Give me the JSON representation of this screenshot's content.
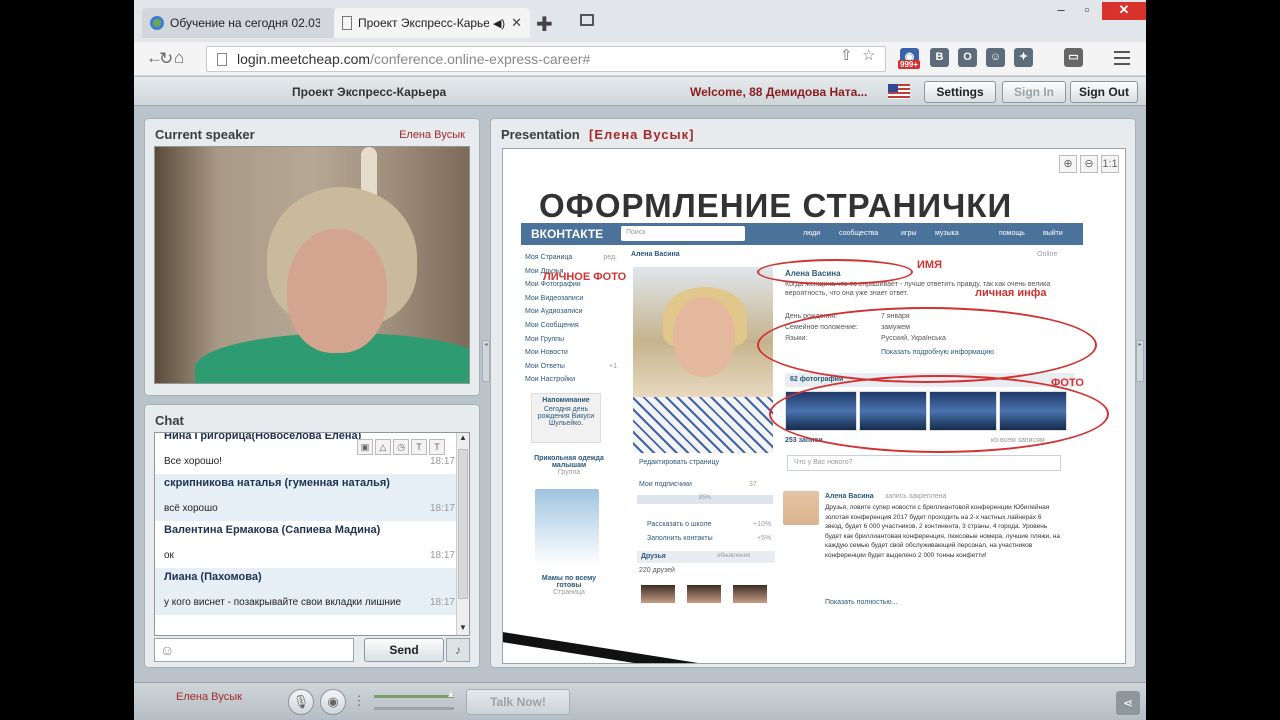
{
  "browser": {
    "tabs": [
      {
        "title": "Обучение на сегодня 02.03."
      },
      {
        "title": "Проект Экспресс-Карьера",
        "audio_icon": "speaker-icon"
      }
    ],
    "url_domain": "login.meetcheap.com",
    "url_path": "/conference.online-express-career#",
    "badge": "999+",
    "extensions": [
      "В",
      "О"
    ]
  },
  "header": {
    "title": "Проект Экспресс-Карьера",
    "welcome": "Welcome, 88 Демидова Ната...",
    "buttons": {
      "settings": "Settings",
      "sign_in": "Sign In",
      "sign_out": "Sign Out"
    }
  },
  "speaker_panel": {
    "title": "Current speaker",
    "name": "Елена Вусык"
  },
  "presentation_panel": {
    "title": "Presentation",
    "presenter": "[Елена Вусык]"
  },
  "chat": {
    "title": "Chat",
    "messages": [
      {
        "author": "Нина Григорица(Новоселова Елена)",
        "text": "Все хорошо!",
        "time": "18:17"
      },
      {
        "author": "скрипникова наталья (гуменная наталья)",
        "text": "всё хорошо",
        "time": "18:17"
      },
      {
        "author": "Валентина Ермакова (Сапиева Мадина)",
        "text": "ок",
        "time": "18:17"
      },
      {
        "author": "Лиана (Пахомова)",
        "text": "у кого виснет - позакрывайте свои вкладки лишние",
        "time": "18:17"
      }
    ],
    "send_label": "Send",
    "tools": [
      "T",
      "T"
    ]
  },
  "slide": {
    "heading": "ОФОРМЛЕНИЕ СТРАНИЧКИ",
    "annotations": {
      "photo": "ЛИЧНОЕ ФОТО",
      "name": "ИМЯ",
      "info": "личная инфа",
      "photos": "ФОТО"
    },
    "vk": {
      "logo": "ВКОНТАКТЕ",
      "search": "Поиск",
      "nav": [
        "люди",
        "сообщества",
        "игры",
        "музыка",
        "помощь",
        "выйти"
      ],
      "menu": [
        {
          "label": "Моя Страница",
          "extra": "ред."
        },
        {
          "label": "Мои Друзья"
        },
        {
          "label": "Мои Фотографии"
        },
        {
          "label": "Мои Видеозаписи"
        },
        {
          "label": "Мои Аудиозаписи"
        },
        {
          "label": "Мои Сообщения"
        },
        {
          "label": "Мои Группы"
        },
        {
          "label": "Мои Новости"
        },
        {
          "label": "Мои Ответы",
          "extra": "+1"
        },
        {
          "label": "Мои Настройки"
        }
      ],
      "reminder_title": "Напоминание",
      "reminder_text": "Сегодня день рождения Викуси Шульейко.",
      "ad1": "Прикольная одежда малышам",
      "ad1_sub": "Группа",
      "ad2": "Мамы по всему готовы",
      "ad2_sub": "Страница",
      "name": "Алена Васина",
      "online": "Online",
      "status": "Когда женщина что-то спрашивает - лучше ответить правду, так как очень велика вероятность, что она уже знает ответ.",
      "info": [
        {
          "label": "День рождения:",
          "value": "7 января"
        },
        {
          "label": "Семейное положение:",
          "value": "замужем"
        },
        {
          "label": "Языки:",
          "value": "Русский, Українська"
        }
      ],
      "show_more": "Показать подробную информацию",
      "photos_header": "62 фотографии",
      "wall_header": "253 записи",
      "wall_link": "ко всем записям",
      "post_placeholder": "Что у Вас нового?",
      "edit_page": "Редактировать страницу",
      "subscribers": "Мои подписчики",
      "subscribers_n": "37",
      "progress_label": "85%",
      "actions": [
        {
          "label": "Рассказать о школе",
          "value": "+10%"
        },
        {
          "label": "Заполнить контакты",
          "value": "+5%"
        }
      ],
      "friends_header": "Друзья",
      "friends_update": "обновления",
      "friends_count": "220 друзей",
      "post_author": "Алена Васина",
      "post_pinned": "запись закреплена",
      "post_text": "Друзья, ловите супер новости с бриллиантовой конференции Юбилейная золотая конференция 2017 будет проходить на 2-х частных лайнерах 6 звезд, будет 6 000 участников, 2 континента, 3 страны, 4 города. Уровень будет как бриллиантовая конференция, люксовые номера, лучшие пляжи, на каждую семью будет свой обслуживающий персонал, на участников конференции будет выделено 2 000 тонны конфетти!",
      "post_more": "Показать полностью..."
    }
  },
  "bottom": {
    "name": "Елена Вусык",
    "talk": "Talk Now!"
  },
  "colors": {
    "accent_red": "#d23131",
    "vk_blue": "#4a729b",
    "name_red": "#a52a2a"
  }
}
